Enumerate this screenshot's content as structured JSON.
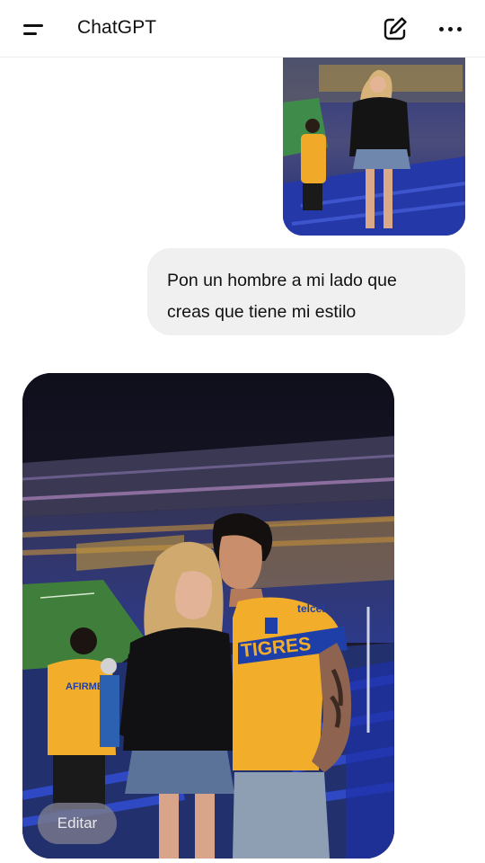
{
  "header": {
    "title": "ChatGPT",
    "menu_icon": "sidebar-menu-icon",
    "compose_icon": "new-chat-pencil-icon",
    "more_icon": "more-horizontal-icon"
  },
  "conversation": {
    "user_image": {
      "kind": "photo",
      "subject": "woman in black sweatshirt in stadium stands"
    },
    "user_message": {
      "line1": "Pon un hombre a mi lado que",
      "line2": "creas que tiene mi estilo"
    },
    "assistant_image": {
      "kind": "generated photo",
      "jersey_text": "TIGRES",
      "sponsor_text": "telcel",
      "kid_jersey_text": "AFIRME"
    },
    "edit_button_label": "Editar"
  },
  "colors": {
    "background": "#ffffff",
    "user_bubble": "#f0f0f0",
    "jersey_yellow": "#f2ad2b",
    "jersey_blue": "#1f3fa8"
  }
}
